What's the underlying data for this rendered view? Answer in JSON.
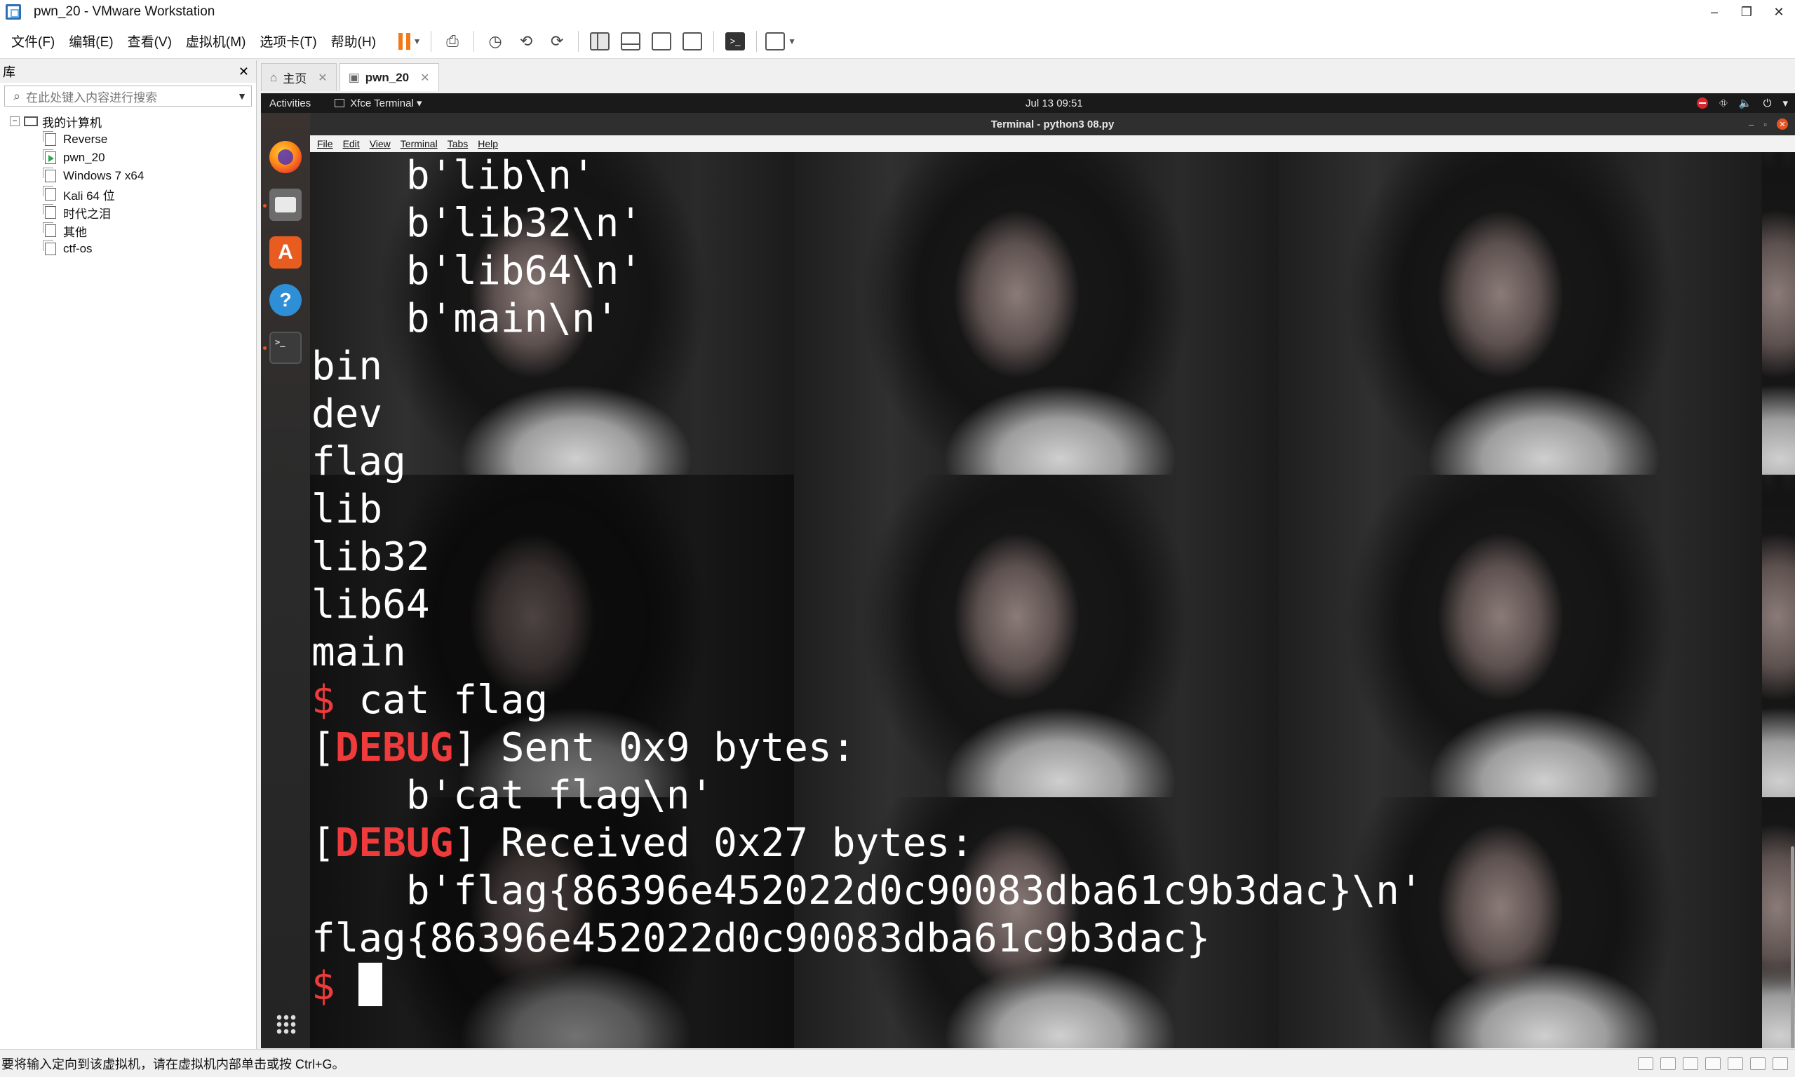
{
  "window": {
    "title": "pwn_20 - VMware Workstation",
    "minimize": "–",
    "restore": "❐",
    "close": "✕"
  },
  "menu": [
    "文件(F)",
    "编辑(E)",
    "查看(V)",
    "虚拟机(M)",
    "选项卡(T)",
    "帮助(H)"
  ],
  "toolbar": {
    "console_label": ">_"
  },
  "library": {
    "title": "库",
    "close": "✕",
    "search_placeholder": "在此处键入内容进行搜索",
    "root": "我的计算机",
    "toggle": "−",
    "items": [
      "Reverse",
      "pwn_20",
      "Windows 7 x64",
      "Kali 64 位",
      "时代之泪",
      "其他",
      "ctf-os"
    ]
  },
  "tabs": [
    {
      "label": "主页",
      "close": "✕"
    },
    {
      "label": "pwn_20",
      "close": "✕"
    }
  ],
  "guest": {
    "activities": "Activities",
    "app_menu": "Xfce Terminal ▾",
    "clock": "Jul 13  09:51",
    "tray": [
      "⛗",
      "🔈",
      "⏻",
      "▾"
    ],
    "software_glyph": "A",
    "help_glyph": "?",
    "terminal_glyph": ">_",
    "window_title": "Terminal - python3 08.py",
    "window_controls": [
      "–",
      "▫"
    ],
    "window_close": "✕",
    "term_menu": [
      "File",
      "Edit",
      "View",
      "Terminal",
      "Tabs",
      "Help"
    ]
  },
  "terminal": {
    "lines": [
      {
        "type": "text",
        "text": "    b'lib\\n'"
      },
      {
        "type": "text",
        "text": "    b'lib32\\n'"
      },
      {
        "type": "text",
        "text": "    b'lib64\\n'"
      },
      {
        "type": "text",
        "text": "    b'main\\n'"
      },
      {
        "type": "text",
        "text": "bin"
      },
      {
        "type": "text",
        "text": "dev"
      },
      {
        "type": "text",
        "text": "flag"
      },
      {
        "type": "text",
        "text": "lib"
      },
      {
        "type": "text",
        "text": "lib32"
      },
      {
        "type": "text",
        "text": "lib64"
      },
      {
        "type": "text",
        "text": "main"
      },
      {
        "type": "prompt",
        "prompt": "$",
        "text": " cat flag"
      },
      {
        "type": "debug",
        "open": "[",
        "tag": "DEBUG",
        "text": "] Sent 0x9 bytes:"
      },
      {
        "type": "text",
        "text": "    b'cat flag\\n'"
      },
      {
        "type": "debug",
        "open": "[",
        "tag": "DEBUG",
        "text": "] Received 0x27 bytes:"
      },
      {
        "type": "text",
        "text": "    b'flag{86396e452022d0c90083dba61c9b3dac}\\n'"
      },
      {
        "type": "text",
        "text": "flag{86396e452022d0c90083dba61c9b3dac}"
      },
      {
        "type": "cursor",
        "prompt": "$",
        "text": " "
      }
    ]
  },
  "status": {
    "message": "要将输入定向到该虚拟机，请在虚拟机内部单击或按 Ctrl+G。"
  },
  "colors": {
    "prompt": "#ef3b3b",
    "pause_accent": "#f07a1a"
  }
}
